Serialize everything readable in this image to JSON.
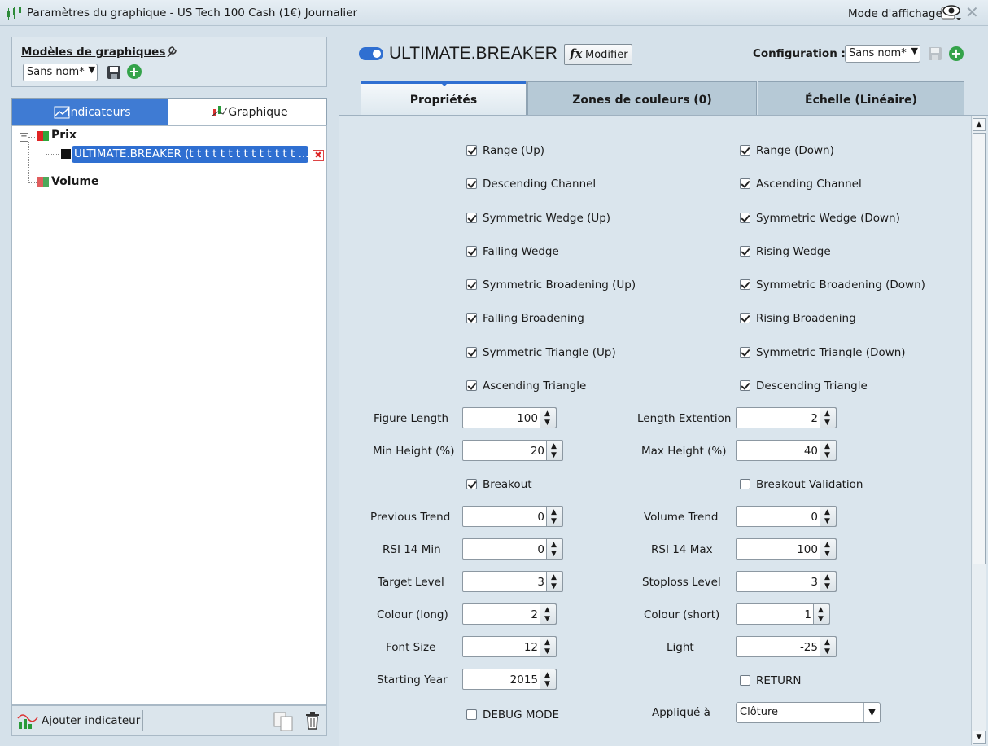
{
  "window": {
    "title": "Paramètres du graphique - US Tech 100 Cash (1€) Journalier",
    "mode_label": "Mode d'affichage"
  },
  "models": {
    "title": "Modèles de graphiques",
    "selected": "Sans nom*"
  },
  "left_tabs": [
    {
      "label": "Indicateurs",
      "active": true
    },
    {
      "label": "Graphique",
      "active": false
    }
  ],
  "tree": {
    "price": "Prix",
    "indicator": "ULTIMATE.BREAKER (t t t t t t t t t t t t t t ...)",
    "volume": "Volume"
  },
  "footer": {
    "add": "Ajouter indicateur"
  },
  "indicator": {
    "name": "ULTIMATE.BREAKER",
    "modify": "Modifier",
    "enabled": true
  },
  "configuration": {
    "label": "Configuration :",
    "selected": "Sans nom*"
  },
  "right_tabs": [
    {
      "label": "Propriétés",
      "active": true
    },
    {
      "label": "Zones de couleurs (0)",
      "active": false
    },
    {
      "label": "Échelle (Linéaire)",
      "active": false
    }
  ],
  "checkboxes": [
    [
      "Range (Up)",
      true
    ],
    [
      "Range (Down)",
      true
    ],
    [
      "Descending Channel",
      true
    ],
    [
      "Ascending Channel",
      true
    ],
    [
      "Symmetric Wedge (Up)",
      true
    ],
    [
      "Symmetric Wedge (Down)",
      true
    ],
    [
      "Falling Wedge",
      true
    ],
    [
      "Rising Wedge",
      true
    ],
    [
      "Symmetric Broadening (Up)",
      true
    ],
    [
      "Symmetric Broadening (Down)",
      true
    ],
    [
      "Falling Broadening",
      true
    ],
    [
      "Rising Broadening",
      true
    ],
    [
      "Symmetric Triangle (Up)",
      true
    ],
    [
      "Symmetric Triangle (Down)",
      true
    ],
    [
      "Ascending Triangle",
      true
    ],
    [
      "Descending Triangle",
      true
    ]
  ],
  "fields": {
    "figure_length": {
      "label": "Figure Length",
      "value": "100"
    },
    "length_extention": {
      "label": "Length Extention",
      "value": "2"
    },
    "min_height": {
      "label": "Min Height (%)",
      "value": "20"
    },
    "max_height": {
      "label": "Max Height (%)",
      "value": "40"
    },
    "breakout": {
      "label": "Breakout",
      "checked": true
    },
    "breakout_validation": {
      "label": "Breakout Validation",
      "checked": false
    },
    "previous_trend": {
      "label": "Previous Trend",
      "value": "0"
    },
    "volume_trend": {
      "label": "Volume Trend",
      "value": "0"
    },
    "rsi_min": {
      "label": "RSI 14 Min",
      "value": "0"
    },
    "rsi_max": {
      "label": "RSI 14 Max",
      "value": "100"
    },
    "target_level": {
      "label": "Target Level",
      "value": "3"
    },
    "stoploss_level": {
      "label": "Stoploss Level",
      "value": "3"
    },
    "colour_long": {
      "label": "Colour (long)",
      "value": "2"
    },
    "colour_short": {
      "label": "Colour (short)",
      "value": "1"
    },
    "font_size": {
      "label": "Font Size",
      "value": "12"
    },
    "light": {
      "label": "Light",
      "value": "-25"
    },
    "starting_year": {
      "label": "Starting Year",
      "value": "2015"
    },
    "return": {
      "label": "RETURN",
      "checked": false
    },
    "debug_mode": {
      "label": "DEBUG MODE",
      "checked": false
    },
    "applied_to": {
      "label": "Appliqué à",
      "value": "Clôture"
    }
  }
}
